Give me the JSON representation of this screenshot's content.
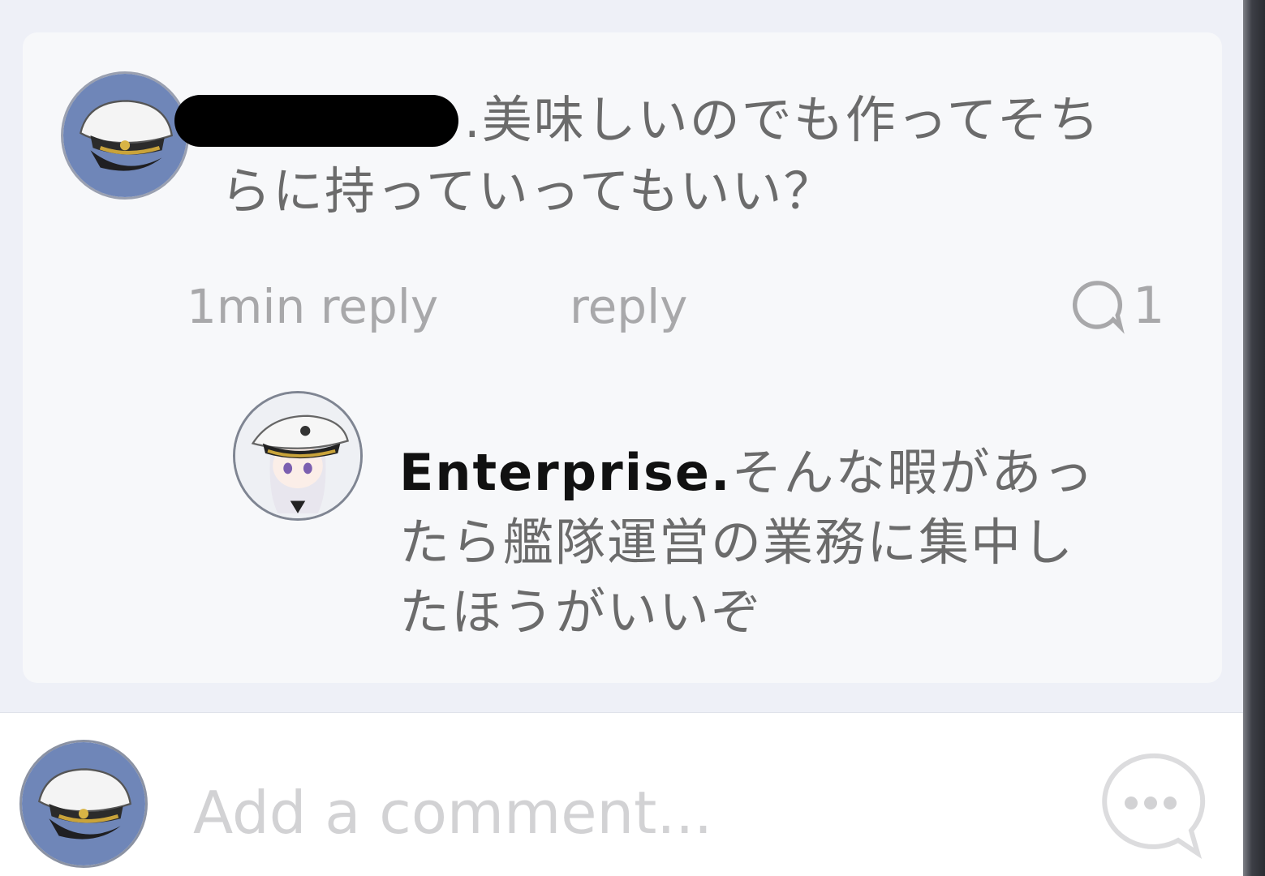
{
  "comment": {
    "text": ".美味しいのでも作ってそちらに持っていってもいい？",
    "time_label": "1min reply",
    "reply_label": "reply",
    "reply_count": "1"
  },
  "reply": {
    "author": "Enterprise.",
    "text": "そんな暇があったら艦隊運営の業務に集中したほうがいいぞ"
  },
  "composer": {
    "placeholder": "Add a comment..."
  },
  "colors": {
    "avatar_bg": "#6f86b8",
    "text_gray": "#6b6b6b",
    "meta_gray": "#a8a8aa"
  },
  "icons": {
    "reply_count": "speech-bubble-icon",
    "chat": "chat-ellipsis-icon",
    "avatar": "captain-hat-icon"
  }
}
